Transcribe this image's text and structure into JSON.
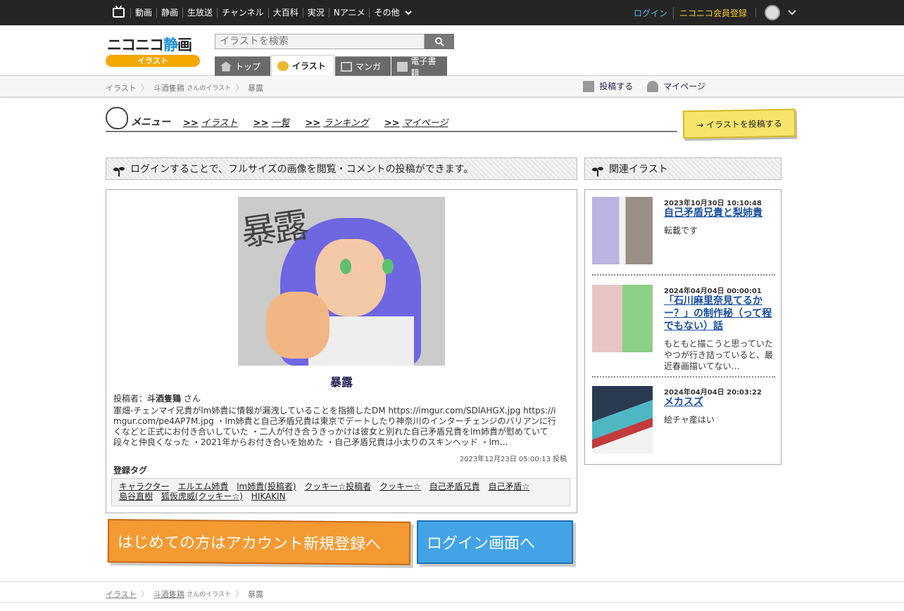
{
  "topnav": {
    "items": [
      "動画",
      "静画",
      "生放送",
      "チャンネル",
      "大百科",
      "実況",
      "Nアニメ",
      "その他"
    ],
    "login": "ログイン",
    "register": "ニコニコ会員登録"
  },
  "logo": {
    "main_a": "ニコニコ",
    "main_b": "静",
    "main_c": "画",
    "sub": "イラスト"
  },
  "search": {
    "placeholder": "イラストを検索"
  },
  "tabs": [
    "トップ",
    "イラスト",
    "マンガ",
    "電子書籍"
  ],
  "breadcrumb": {
    "root": "イラスト",
    "user": "斗酒隻鶏",
    "user_suffix": "さんのイラスト",
    "current": "暴露"
  },
  "subbar": {
    "post": "投稿する",
    "mypage": "マイページ"
  },
  "menu": {
    "title": "メニュー",
    "arrow": ">>",
    "items": [
      "イラスト",
      "一覧",
      "ランキング",
      "マイページ"
    ],
    "post_button": "→ イラストを投稿する"
  },
  "main": {
    "heading": "ログインすることで、フルサイズの画像を閲覧・コメントの投稿ができます。",
    "art_text": "暴露",
    "title": "暴露",
    "poster_label": "投稿者：",
    "poster_name": "斗酒隻鶏",
    "poster_suffix": " さん",
    "description": "軍畑-チェンマイ兄貴がlm姉貴に情報が漏洩していることを指摘したDM https://imgur.com/SDlAHGX.jpg https://imgur.com/pe4AP7M.jpg ・lm姉貴と自己矛盾兄貴は東京でデートしたり神奈川のインターチェンジのバリアンに行くなどと正式にお付き合いしていた ・二人が付き合うきっかけは彼女と別れた自己矛盾兄貴をlm姉貴が慰めていて段々と仲良くなった ・2021年からお付き合いを始めた ・自己矛盾兄貴は小太りのスキンヘッド ・lm…",
    "date": "2023年12月23日 05:00:13 投稿",
    "tags_label": "登録タグ",
    "tags": [
      "キャラクター",
      "エルエム姉貴",
      "lm姉貴(投稿者)",
      "クッキー☆投稿者",
      "クッキー☆",
      "自己矛盾兄貴",
      "自己矛盾☆",
      "島谷直樹",
      "狐仮虎威(クッキー☆)",
      "HIKAKIN"
    ]
  },
  "buttons": {
    "register": "はじめての方はアカウント新規登録へ",
    "login": "ログイン画面へ"
  },
  "related": {
    "heading": "関連イラスト",
    "items": [
      {
        "date": "2023年10月30日 10:10:48",
        "title": "自己矛盾兄貴と梨姉貴",
        "desc": "転載です"
      },
      {
        "date": "2024年04月04日 00:00:01",
        "title": "「石川麻里奈見てるかー？」の制作秘（って程でもない）話",
        "desc": "もともと描こうと思っていたやつが行き詰っていると、最近春画描いてない…"
      },
      {
        "date": "2024年04月04日 20:03:22",
        "title": "メカスズ",
        "desc": "絵チャ産はい"
      }
    ]
  }
}
